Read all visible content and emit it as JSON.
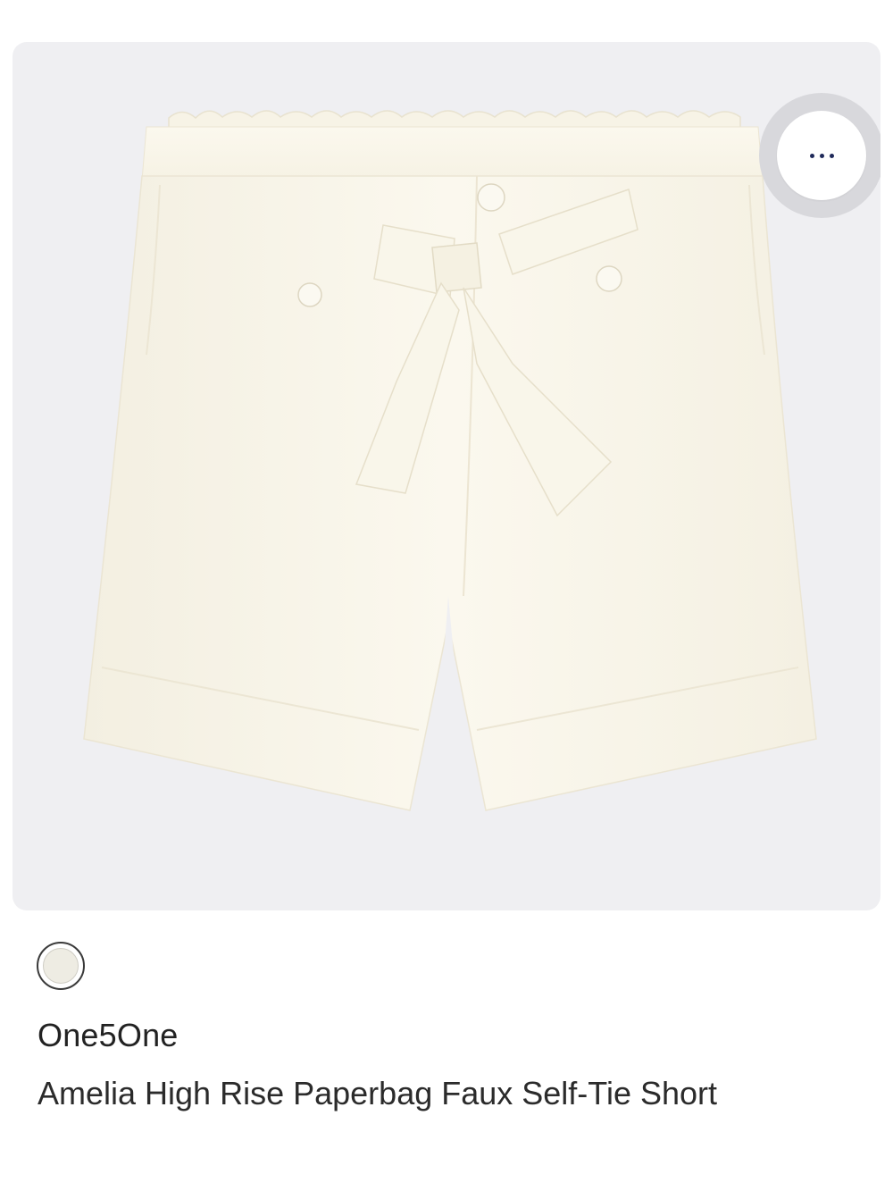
{
  "product": {
    "brand": "One5One",
    "name": "Amelia High Rise Paperbag Faux Self-Tie Short",
    "image_description_icon": "shorts-image",
    "colors": {
      "card_background": "#efeff2",
      "swatch": "#eeece3",
      "dots": "#1f2a5a"
    }
  },
  "actions": {
    "more_icon": "more-options-icon"
  }
}
